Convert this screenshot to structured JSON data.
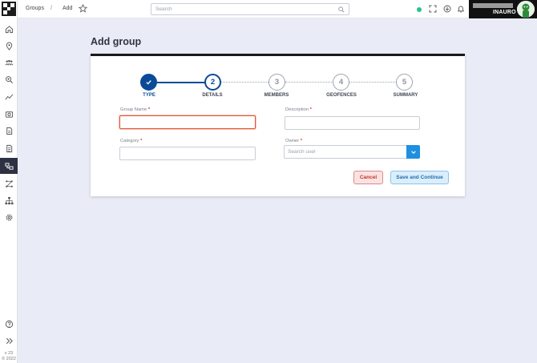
{
  "sidebar": {
    "icons": [
      "home-icon",
      "location-pin-icon",
      "people-group-icon",
      "search-zoom-icon",
      "chart-line-icon",
      "camera-icon",
      "document-icon",
      "report-icon",
      "groups-icon",
      "route-icon",
      "hierarchy-icon",
      "settings-icon"
    ],
    "active": "groups-icon",
    "help_icon": "help-circle-icon",
    "expand_icon": "double-chevron-right-icon",
    "version": "v 23",
    "copyright": "© 2022"
  },
  "topbar": {
    "breadcrumb": [
      "Groups",
      "/",
      "Add"
    ],
    "search_placeholder": "Search",
    "organization": "INAURO",
    "status_color": "#25c28a"
  },
  "page": {
    "title": "Add group"
  },
  "stepper": {
    "steps": [
      {
        "number": "",
        "label": "TYPE",
        "state": "done"
      },
      {
        "number": "2",
        "label": "DETAILS",
        "state": "current"
      },
      {
        "number": "3",
        "label": "MEMBERS",
        "state": "todo"
      },
      {
        "number": "4",
        "label": "GEOFENCES",
        "state": "todo"
      },
      {
        "number": "5",
        "label": "SUMMARY",
        "state": "todo"
      }
    ]
  },
  "form": {
    "group_name": {
      "label": "Group Name",
      "required": "*",
      "value": ""
    },
    "description": {
      "label": "Description",
      "required": "*",
      "value": ""
    },
    "category": {
      "label": "Category",
      "required": "*",
      "value": ""
    },
    "owner": {
      "label": "Owner",
      "required": "*",
      "placeholder": "Search user"
    }
  },
  "actions": {
    "cancel": "Cancel",
    "save": "Save and Continue"
  },
  "colors": {
    "accent": "#0b4a96",
    "dropdown": "#1f8fe0",
    "cancel": "#c0392b"
  }
}
